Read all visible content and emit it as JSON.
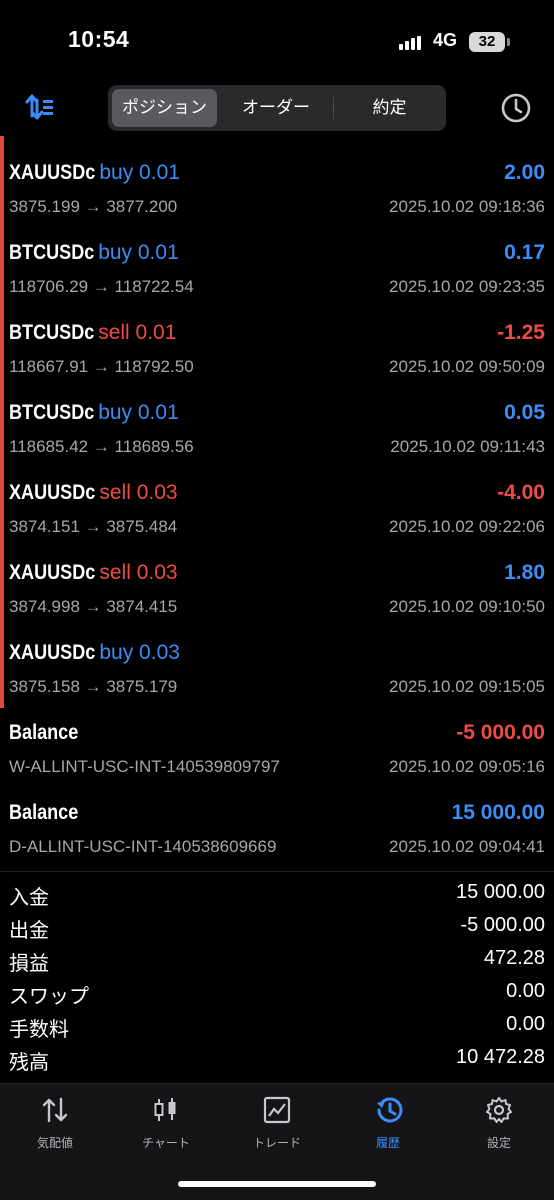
{
  "status": {
    "time": "10:54",
    "network": "4G",
    "battery": "32"
  },
  "nav": {
    "tabs": [
      {
        "label": "ポジション",
        "active": true
      },
      {
        "label": "オーダー",
        "active": false
      },
      {
        "label": "約定",
        "active": false
      }
    ]
  },
  "deals": [
    {
      "symbol": "XAUUSDc",
      "side": "buy 0.01",
      "profit": "2.00",
      "prices": "3875.199 → 3877.200",
      "time": "2025.10.02 09:18:36",
      "side_color": "blue",
      "profit_color": "blue"
    },
    {
      "symbol": "BTCUSDc",
      "side": "buy 0.01",
      "profit": "0.17",
      "prices": "118706.29 → 118722.54",
      "time": "2025.10.02 09:23:35",
      "side_color": "blue",
      "profit_color": "blue"
    },
    {
      "symbol": "BTCUSDc",
      "side": "sell 0.01",
      "profit": "-1.25",
      "prices": "118667.91 → 118792.50",
      "time": "2025.10.02 09:50:09",
      "side_color": "red",
      "profit_color": "red"
    },
    {
      "symbol": "BTCUSDc",
      "side": "buy 0.01",
      "profit": "0.05",
      "prices": "118685.42 → 118689.56",
      "time": "2025.10.02 09:11:43",
      "side_color": "blue",
      "profit_color": "blue"
    },
    {
      "symbol": "XAUUSDc",
      "side": "sell 0.03",
      "profit": "-4.00",
      "prices": "3874.151 → 3875.484",
      "time": "2025.10.02 09:22:06",
      "side_color": "red",
      "profit_color": "red"
    },
    {
      "symbol": "XAUUSDc",
      "side": "sell 0.03",
      "profit": "1.80",
      "prices": "3874.998 → 3874.415",
      "time": "2025.10.02 09:10:50",
      "side_color": "red",
      "profit_color": "blue"
    },
    {
      "symbol": "XAUUSDc",
      "side": "buy 0.03",
      "profit": "",
      "prices": "3875.158 → 3875.179",
      "time": "2025.10.02 09:15:05",
      "side_color": "blue",
      "profit_color": "blue"
    },
    {
      "symbol": "Balance",
      "side": "",
      "profit": "-5 000.00",
      "prices": "W-ALLINT-USC-INT-140539809797",
      "time": "2025.10.02 09:05:16",
      "side_color": "blue",
      "profit_color": "red"
    },
    {
      "symbol": "Balance",
      "side": "",
      "profit": "15 000.00",
      "prices": "D-ALLINT-USC-INT-140538609669",
      "time": "2025.10.02 09:04:41",
      "side_color": "blue",
      "profit_color": "blue"
    }
  ],
  "summary": [
    {
      "label": "入金",
      "value": "15 000.00"
    },
    {
      "label": "出金",
      "value": "-5 000.00"
    },
    {
      "label": "損益",
      "value": "472.28"
    },
    {
      "label": "スワップ",
      "value": "0.00"
    },
    {
      "label": "手数料",
      "value": "0.00"
    },
    {
      "label": "残高",
      "value": "10 472.28"
    }
  ],
  "tabbar": [
    {
      "label": "気配値",
      "icon": "quotes-arrows-icon",
      "active": false
    },
    {
      "label": "チャート",
      "icon": "candlestick-icon",
      "active": false
    },
    {
      "label": "トレード",
      "icon": "trade-chart-icon",
      "active": false
    },
    {
      "label": "履歴",
      "icon": "history-clock-icon",
      "active": true
    },
    {
      "label": "設定",
      "icon": "gear-icon",
      "active": false
    }
  ],
  "colors": {
    "blue": "#3c8df7",
    "red": "#ef4b45",
    "accent_bar": "#e5473e",
    "tab_active": "#3c8df7"
  }
}
